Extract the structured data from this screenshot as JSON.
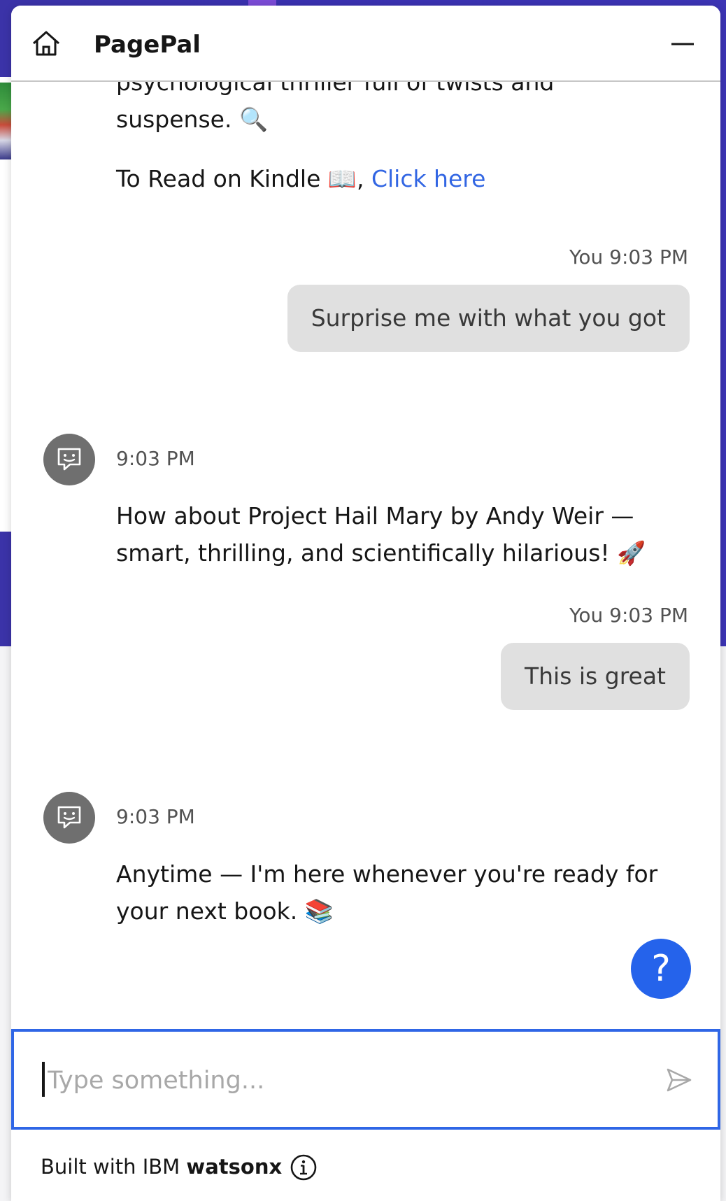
{
  "header": {
    "title": "PagePal",
    "home_icon": "home-icon",
    "minimize_icon": "minimize-icon"
  },
  "messages": [
    {
      "sender": "bot",
      "lines": [
        "psychological thriller full of twists and",
        "suspense. 🔍"
      ],
      "kindle_text": "To Read on Kindle 📖, ",
      "link_text": "Click here"
    },
    {
      "sender": "user",
      "meta": "You 9:03 PM",
      "text": "Surprise me with what you got"
    },
    {
      "sender": "bot",
      "time": "9:03 PM",
      "lines": [
        "How about Project Hail Mary by Andy Weir —",
        "smart, thrilling, and scientifically hilarious! 🚀"
      ]
    },
    {
      "sender": "user",
      "meta": "You 9:03 PM",
      "text": "This is great"
    },
    {
      "sender": "bot",
      "time": "9:03 PM",
      "lines": [
        "Anytime — I'm here whenever you're ready for",
        "your next book. 📚"
      ]
    }
  ],
  "help": {
    "label": "?"
  },
  "input": {
    "placeholder": "Type something...",
    "value": ""
  },
  "footer": {
    "prefix": "Built with IBM ",
    "brand": "watsonx"
  },
  "icons": {
    "bot_avatar": "chat-bot-icon",
    "send": "send-icon",
    "info": "info-icon"
  },
  "colors": {
    "accent": "#2563eb",
    "link": "#3266e3",
    "user_bubble": "#e0e0e0",
    "avatar": "#6f6f6f"
  }
}
